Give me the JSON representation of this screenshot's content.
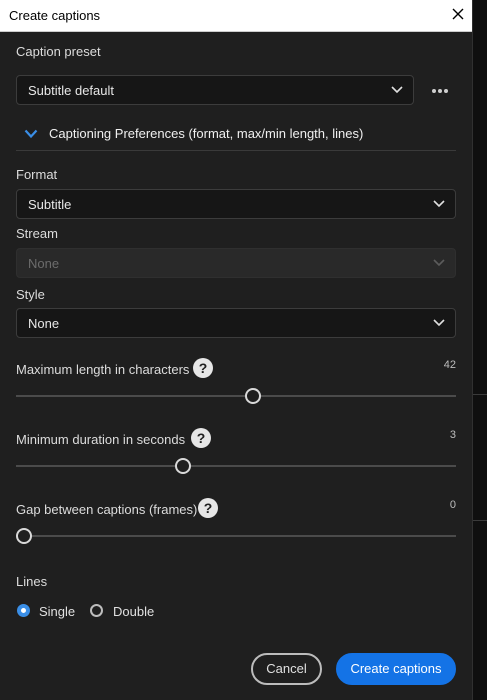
{
  "dialog": {
    "title": "Create captions"
  },
  "caption_preset": {
    "label": "Caption preset",
    "value": "Subtitle default"
  },
  "section": {
    "label": "Captioning Preferences (format, max/min length, lines)"
  },
  "format": {
    "label": "Format",
    "value": "Subtitle"
  },
  "stream": {
    "label": "Stream",
    "value": "None",
    "disabled": true
  },
  "style": {
    "label": "Style",
    "value": "None"
  },
  "max_length": {
    "label": "Maximum length in characters",
    "value": "42",
    "slider_fraction": 0.538
  },
  "min_duration": {
    "label": "Minimum duration in seconds",
    "value": "3",
    "slider_fraction": 0.38
  },
  "gap": {
    "label": "Gap between captions (frames)",
    "value": "0",
    "slider_fraction": 0.0
  },
  "lines": {
    "label": "Lines",
    "options": [
      {
        "label": "Single",
        "selected": true
      },
      {
        "label": "Double",
        "selected": false
      }
    ]
  },
  "buttons": {
    "cancel": "Cancel",
    "create": "Create captions"
  },
  "colors": {
    "accent": "#1473e6",
    "radio_selected": "#3a8ee6",
    "dialog_bg": "#1f1f1f"
  },
  "icons": {
    "close": "close-icon",
    "dropdown": "chevron-down-icon",
    "more": "more-horizontal-icon",
    "collapse": "chevron-down-icon",
    "help": "help-icon"
  }
}
